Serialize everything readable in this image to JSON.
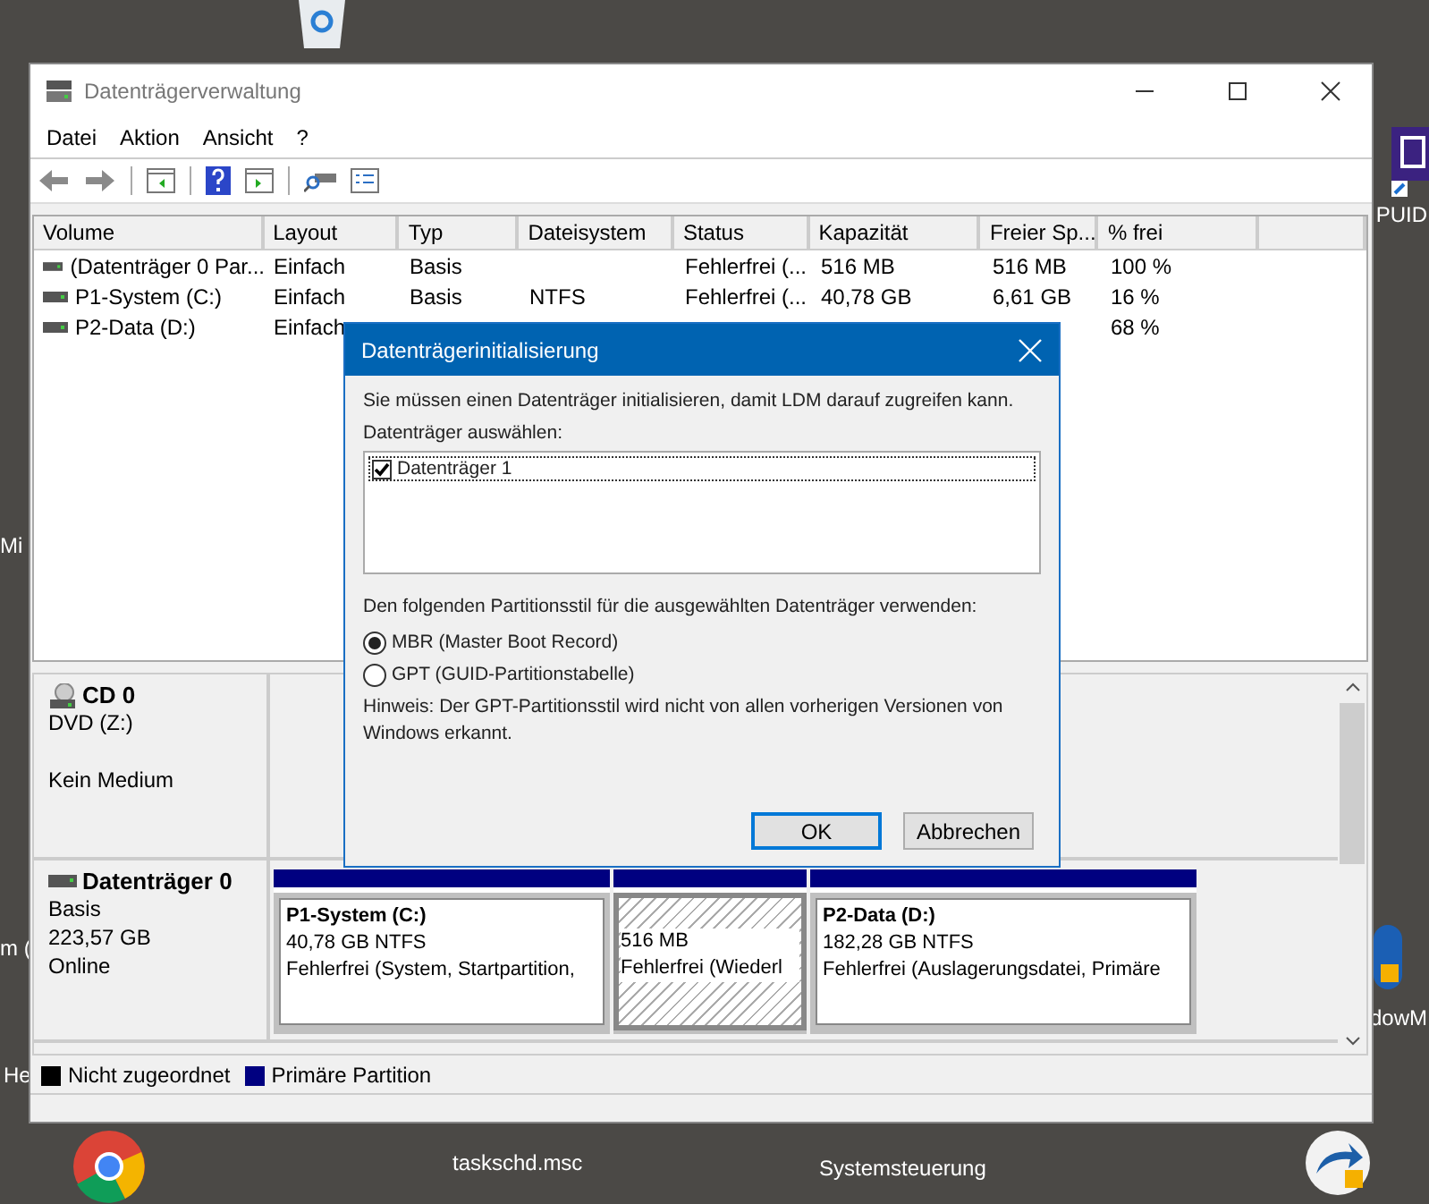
{
  "desktop_labels": [
    "Mi",
    "m (",
    "He",
    "PUID",
    "dowM",
    "taskschd.msc",
    "Systemsteuerung"
  ],
  "window": {
    "title": "Datenträgerverwaltung"
  },
  "menu": [
    "Datei",
    "Aktion",
    "Ansicht",
    "?"
  ],
  "volume_table": {
    "columns": [
      "Volume",
      "Layout",
      "Typ",
      "Dateisystem",
      "Status",
      "Kapazität",
      "Freier Sp...",
      "% frei"
    ],
    "rows": [
      {
        "volume": "(Datenträger 0 Par...",
        "layout": "Einfach",
        "type": "Basis",
        "status": "Fehlerfrei (...",
        "capacity": "516 MB",
        "free_space": "516 MB",
        "percent_free": "100 %"
      },
      {
        "volume": "P1-System (C:)",
        "layout": "Einfach",
        "type": "Basis",
        "filesystem": "NTFS",
        "status": "Fehlerfrei (...",
        "capacity": "40,78 GB",
        "free_space": "6,61 GB",
        "percent_free": "16 %"
      },
      {
        "volume": "P2-Data (D:)",
        "layout": "Einfach",
        "percent_free": "68 %"
      }
    ]
  },
  "disks": [
    {
      "kind": "cdrom",
      "name": "CD 0",
      "type": "DVD (Z:)",
      "status": "Kein Medium"
    },
    {
      "kind": "disk",
      "name": "Datenträger 0",
      "type": "Basis",
      "size": "223,57 GB",
      "status": "Online",
      "partitions": [
        {
          "name": "P1-System  (C:)",
          "size": "40,78 GB NTFS",
          "status": "Fehlerfrei (System, Startpartition,",
          "selected": false
        },
        {
          "size": "516 MB",
          "status": "Fehlerfrei (Wiederl",
          "selected": true
        },
        {
          "name": "P2-Data  (D:)",
          "size": "182,28 GB NTFS",
          "status": "Fehlerfrei (Auslagerungsdatei, Primäre",
          "selected": false
        }
      ]
    }
  ],
  "legend": [
    {
      "label": "Nicht zugeordnet",
      "color": "#000000"
    },
    {
      "label": "Primäre Partition",
      "color": "#000080"
    }
  ],
  "dialog": {
    "title": "Datenträgerinitialisierung",
    "intro": "Sie müssen einen Datenträger initialisieren, damit LDM darauf zugreifen kann.",
    "list_label": "Datenträger auswählen:",
    "disks": [
      {
        "label": "Datenträger 1",
        "checked": true
      }
    ],
    "style_label": "Den folgenden Partitionsstil für die ausgewählten Datenträger verwenden:",
    "styles": [
      {
        "label": "MBR (Master Boot Record)",
        "selected": true
      },
      {
        "label": "GPT (GUID-Partitionstabelle)",
        "selected": false
      }
    ],
    "note": "Hinweis: Der GPT-Partitionsstil wird nicht von allen vorherigen Versionen von Windows erkannt.",
    "buttons": [
      {
        "label": "OK",
        "default": true
      },
      {
        "label": "Abbrechen",
        "default": false
      }
    ]
  }
}
